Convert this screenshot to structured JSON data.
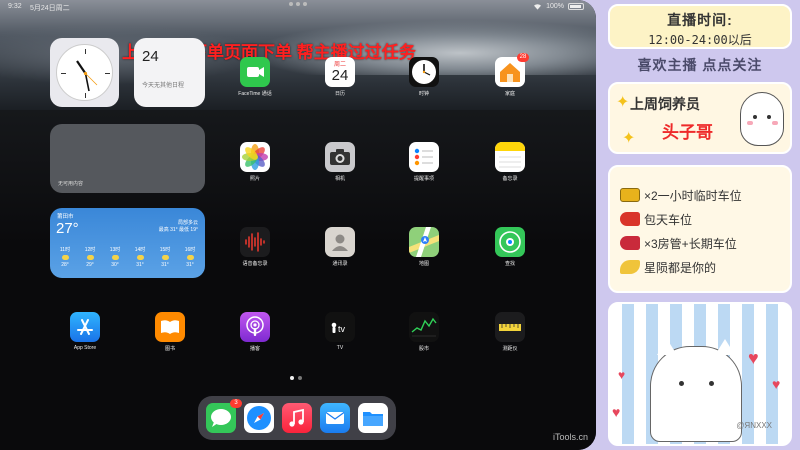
{
  "status_bar": {
    "time": "9:32",
    "date": "5月24日周二",
    "wifi": "wifi-icon",
    "battery_text": "100%"
  },
  "banner_text": "上车的点下单页面下单 帮主播过过任务",
  "widgets": {
    "calendar": {
      "day_num": "24",
      "note": "今天无其他日程"
    },
    "empty_widget_label": "无可用内容",
    "weather": {
      "city": "莆田市",
      "temp": "27°",
      "condition": "局部多云",
      "range": "最高 31° 最低 19°",
      "forecast": [
        {
          "time": "11时",
          "temp": "28°"
        },
        {
          "time": "12时",
          "temp": "29°"
        },
        {
          "time": "13时",
          "temp": "30°"
        },
        {
          "time": "14时",
          "temp": "31°"
        },
        {
          "time": "15时",
          "temp": "31°"
        },
        {
          "time": "16时",
          "temp": "31°"
        }
      ]
    }
  },
  "apps": {
    "facetime": "FaceTime 通话",
    "calendar": "日历",
    "calendar_weekday": "周二",
    "calendar_day": "24",
    "clock": "时钟",
    "home": "家庭",
    "home_badge": "28",
    "photos": "照片",
    "camera": "相机",
    "reminders": "提醒事项",
    "notes": "备忘录",
    "voice_memos": "语音备忘录",
    "contacts": "通讯录",
    "maps": "地图",
    "find_my": "查找",
    "app_store": "App Store",
    "books": "图书",
    "podcasts": "播客",
    "tv": "TV",
    "stocks": "股市",
    "measure": "测距仪"
  },
  "dock": {
    "messages_badge": "3"
  },
  "watermark": "iTools.cn",
  "panel": {
    "schedule_title": "直播时间:",
    "schedule_time": "12:00-24:00以后",
    "follow": "喜欢主播 点点关注",
    "top_fan_title": "上周饲养员",
    "top_fan_name": "头子哥",
    "perks": [
      {
        "icon": "gold-bar-icon",
        "text": "×2一小时临时车位"
      },
      {
        "icon": "car-icon",
        "text": "包天车位"
      },
      {
        "icon": "car-icon",
        "text": "×3房管+长期车位"
      },
      {
        "icon": "rocket-icon",
        "text": "星陨都是你的"
      }
    ],
    "card_watermark": "@ЯNXXX"
  },
  "colors": {
    "banner": "#ff2020",
    "panel_bg": "#cec8ee",
    "fan_name": "#ee2a2a"
  }
}
